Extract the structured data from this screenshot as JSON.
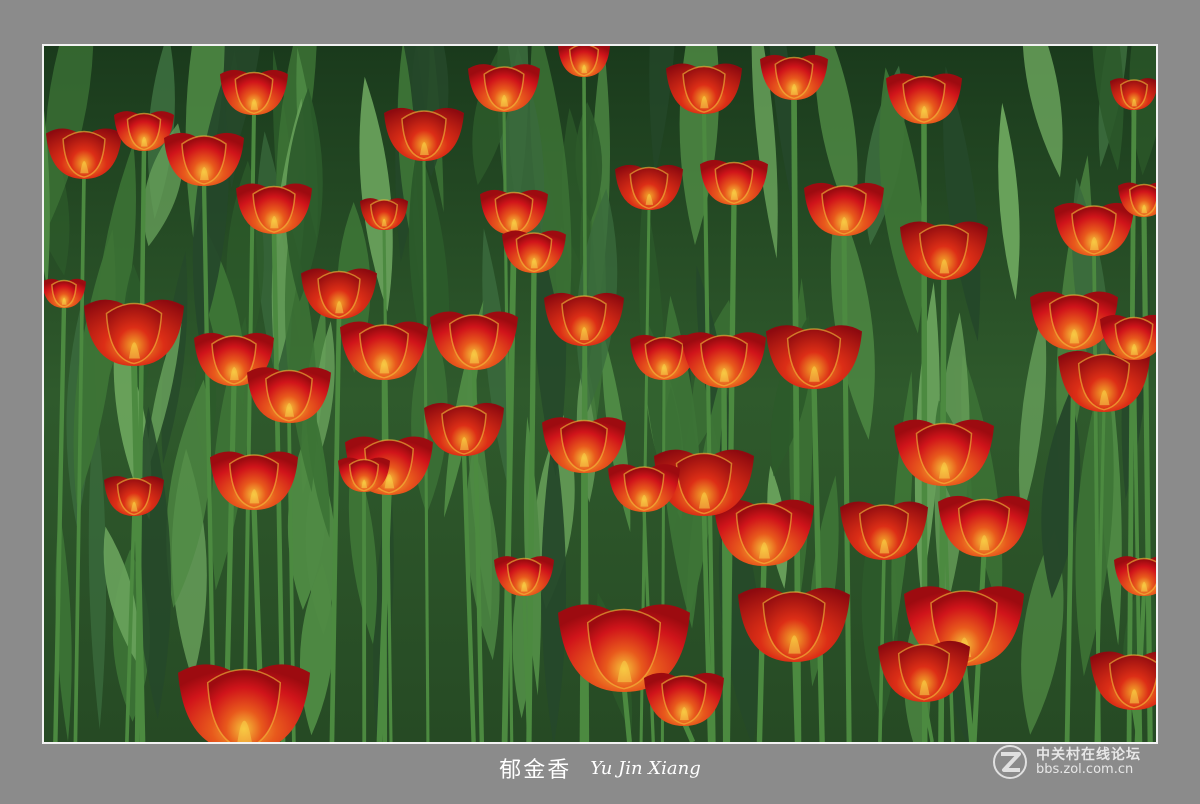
{
  "photo": {
    "subject": "tulip-field-image",
    "colors": {
      "frame": "#8b8b8b",
      "border": "#f2f2f2",
      "foliage_dark": "#1d3a1f",
      "foliage_light": "#5f9a55",
      "petal_red": "#d0141a",
      "petal_deep": "#a00c12",
      "petal_yellow": "#f2b22a"
    }
  },
  "caption": {
    "chinese": "郁金香",
    "english": "Yu Jin Xiang"
  },
  "watermark": {
    "name": "中关村在线论坛",
    "url": "bbs.zol.com.cn",
    "logo_icon": "zol-z-logo-icon"
  }
}
